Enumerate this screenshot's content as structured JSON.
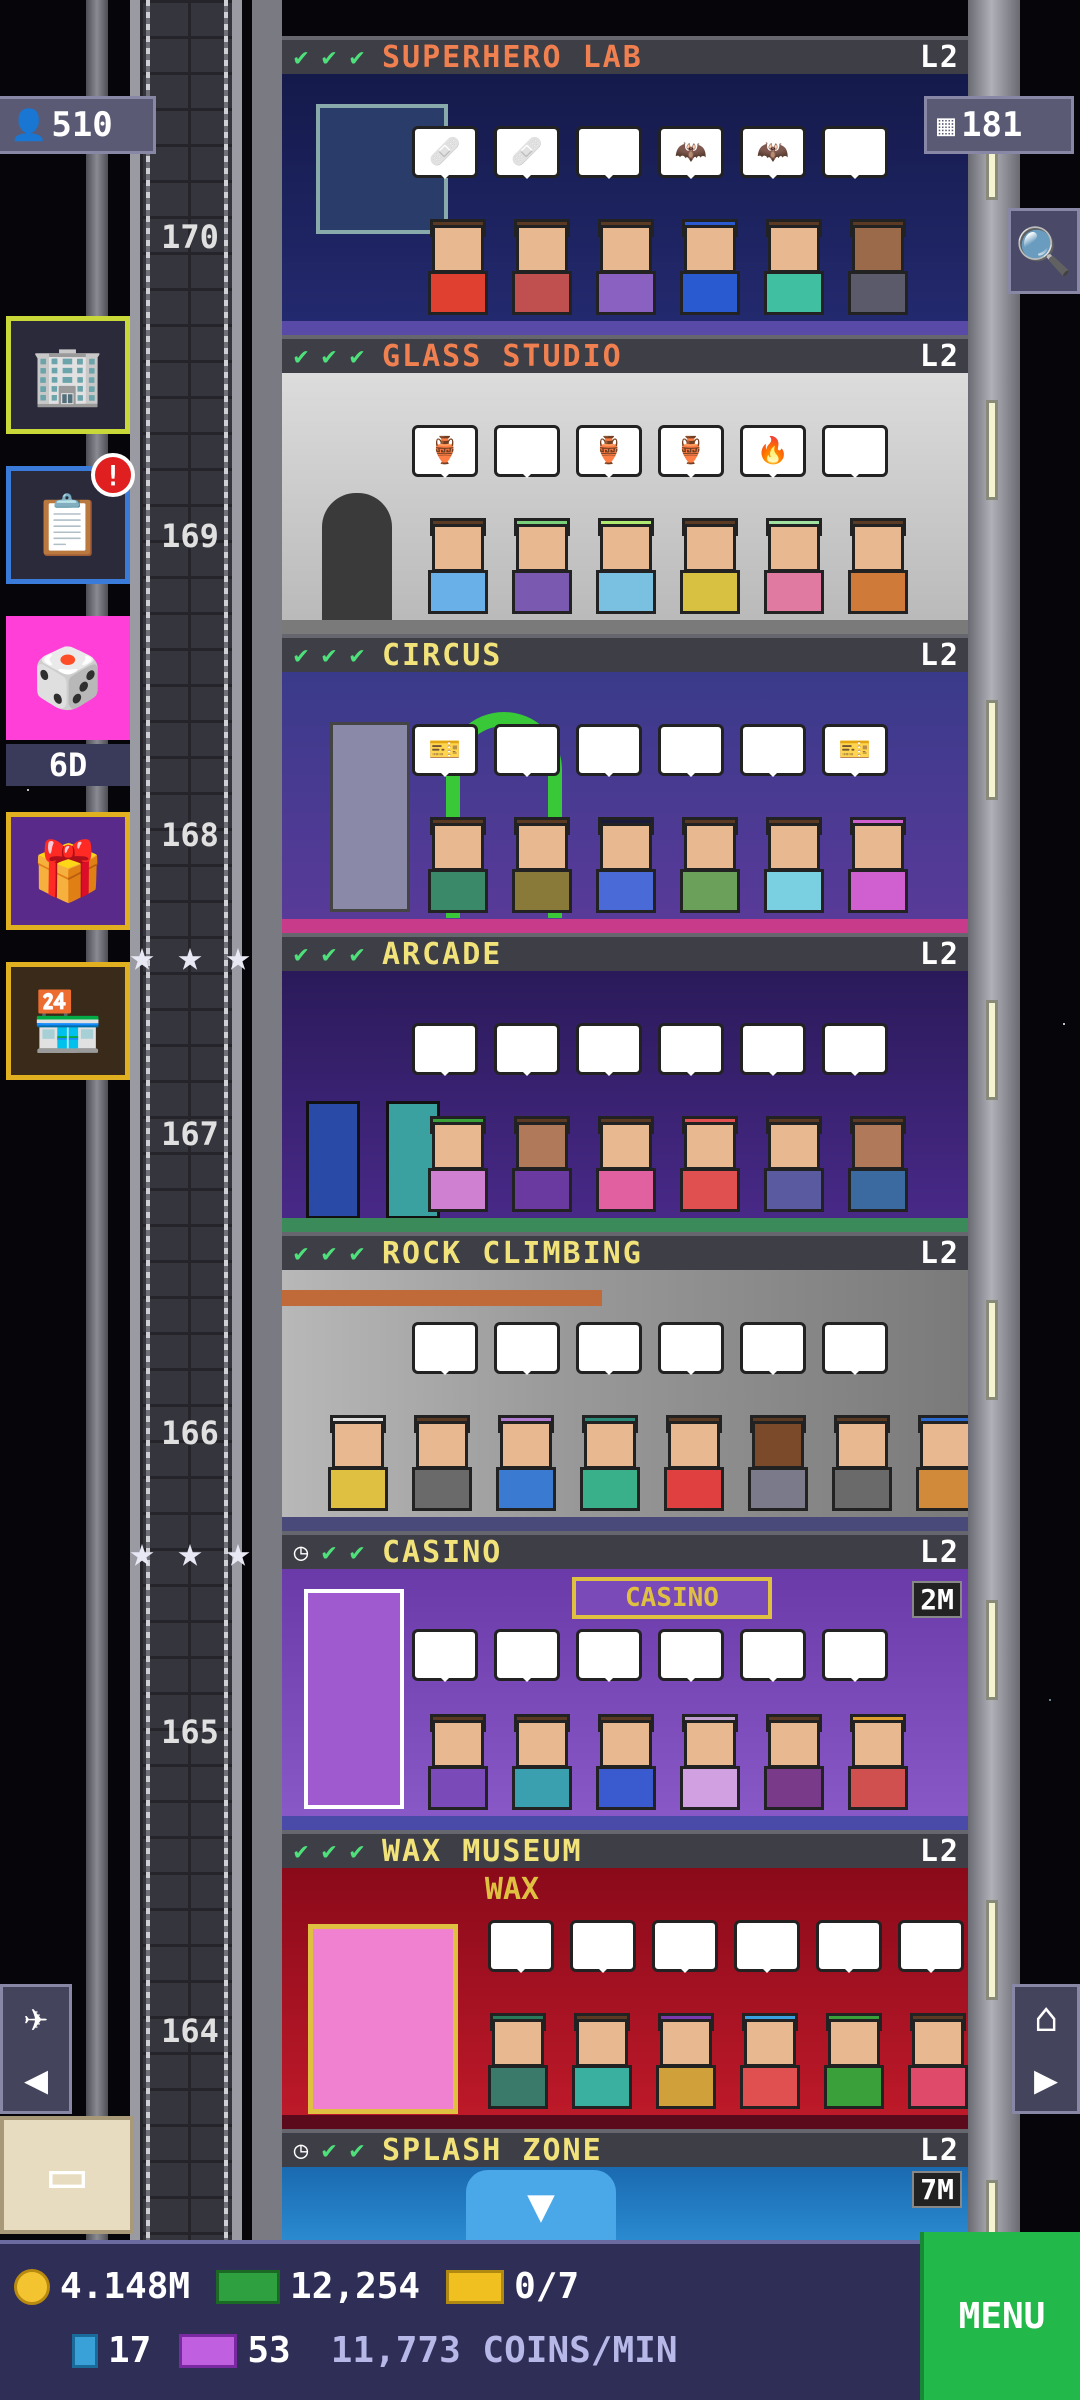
{
  "top": {
    "population": "510",
    "floors": "181"
  },
  "floors": [
    {
      "name": "SUPERHERO LAB",
      "level": "L2"
    },
    {
      "name": "GLASS STUDIO",
      "level": "L2"
    },
    {
      "name": "CIRCUS",
      "level": "L2"
    },
    {
      "name": "ARCADE",
      "level": "L2"
    },
    {
      "name": "ROCK CLIMBING",
      "level": "L2"
    },
    {
      "name": "CASINO",
      "level": "L2",
      "timer": "2M",
      "sign": "CASINO"
    },
    {
      "name": "WAX MUSEUM",
      "level": "L2",
      "sign": "WAX"
    },
    {
      "name": "SPLASH ZONE",
      "level": "L2",
      "timer": "7M"
    }
  ],
  "floor_numbers": [
    "170",
    "169",
    "168",
    "167",
    "166",
    "165",
    "164"
  ],
  "side": {
    "mission_badge": "!",
    "dice_timer": "6D"
  },
  "hud": {
    "coins": "4.148M",
    "bux": "12,254",
    "vip": "0/7",
    "tickets": "17",
    "golden": "53",
    "coins_per_min": "11,773 COINS/MIN",
    "menu_label": "MENU"
  },
  "colors": {
    "check": "#4ee07a",
    "header_name_orange": "#f08050",
    "header_name_yellow": "#f2e27a",
    "menu": "#22b84a",
    "hud": "#2e2e56"
  }
}
